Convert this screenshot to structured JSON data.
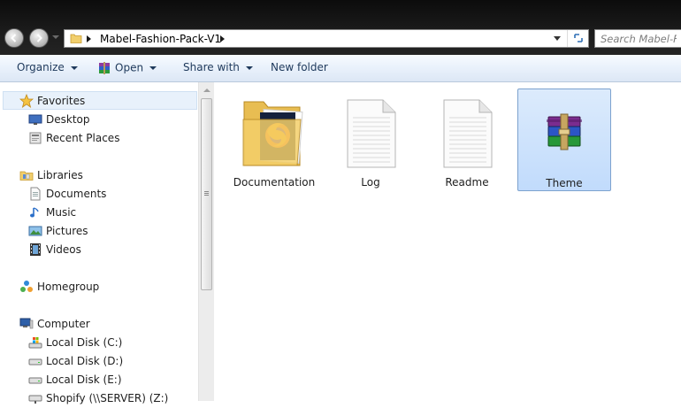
{
  "address": {
    "path": "Mabel-Fashion-Pack-V1"
  },
  "search": {
    "placeholder": "Search Mabel-Fa"
  },
  "commands": {
    "organize": "Organize",
    "open": "Open",
    "share_with": "Share with",
    "new_folder": "New folder"
  },
  "navigation": {
    "favorites": {
      "label": "Favorites",
      "items": [
        "Desktop",
        "Recent Places"
      ]
    },
    "libraries": {
      "label": "Libraries",
      "items": [
        "Documents",
        "Music",
        "Pictures",
        "Videos"
      ]
    },
    "homegroup": "Homegroup",
    "computer": {
      "label": "Computer",
      "items": [
        "Local Disk (C:)",
        "Local Disk (D:)",
        "Local Disk (E:)",
        "Shopify (\\\\SERVER) (Z:)"
      ]
    }
  },
  "files": [
    {
      "name": "Documentation",
      "icon": "folder-with-firefox-icon",
      "selected": false
    },
    {
      "name": "Log",
      "icon": "text-document-icon",
      "selected": false
    },
    {
      "name": "Readme",
      "icon": "text-document-icon",
      "selected": false
    },
    {
      "name": "Theme",
      "icon": "winrar-archive-icon",
      "selected": true
    }
  ],
  "colors": {
    "command_text": "#1e395b",
    "selection_bg": "#c1dbfc",
    "selection_border": "#7da2ce"
  }
}
